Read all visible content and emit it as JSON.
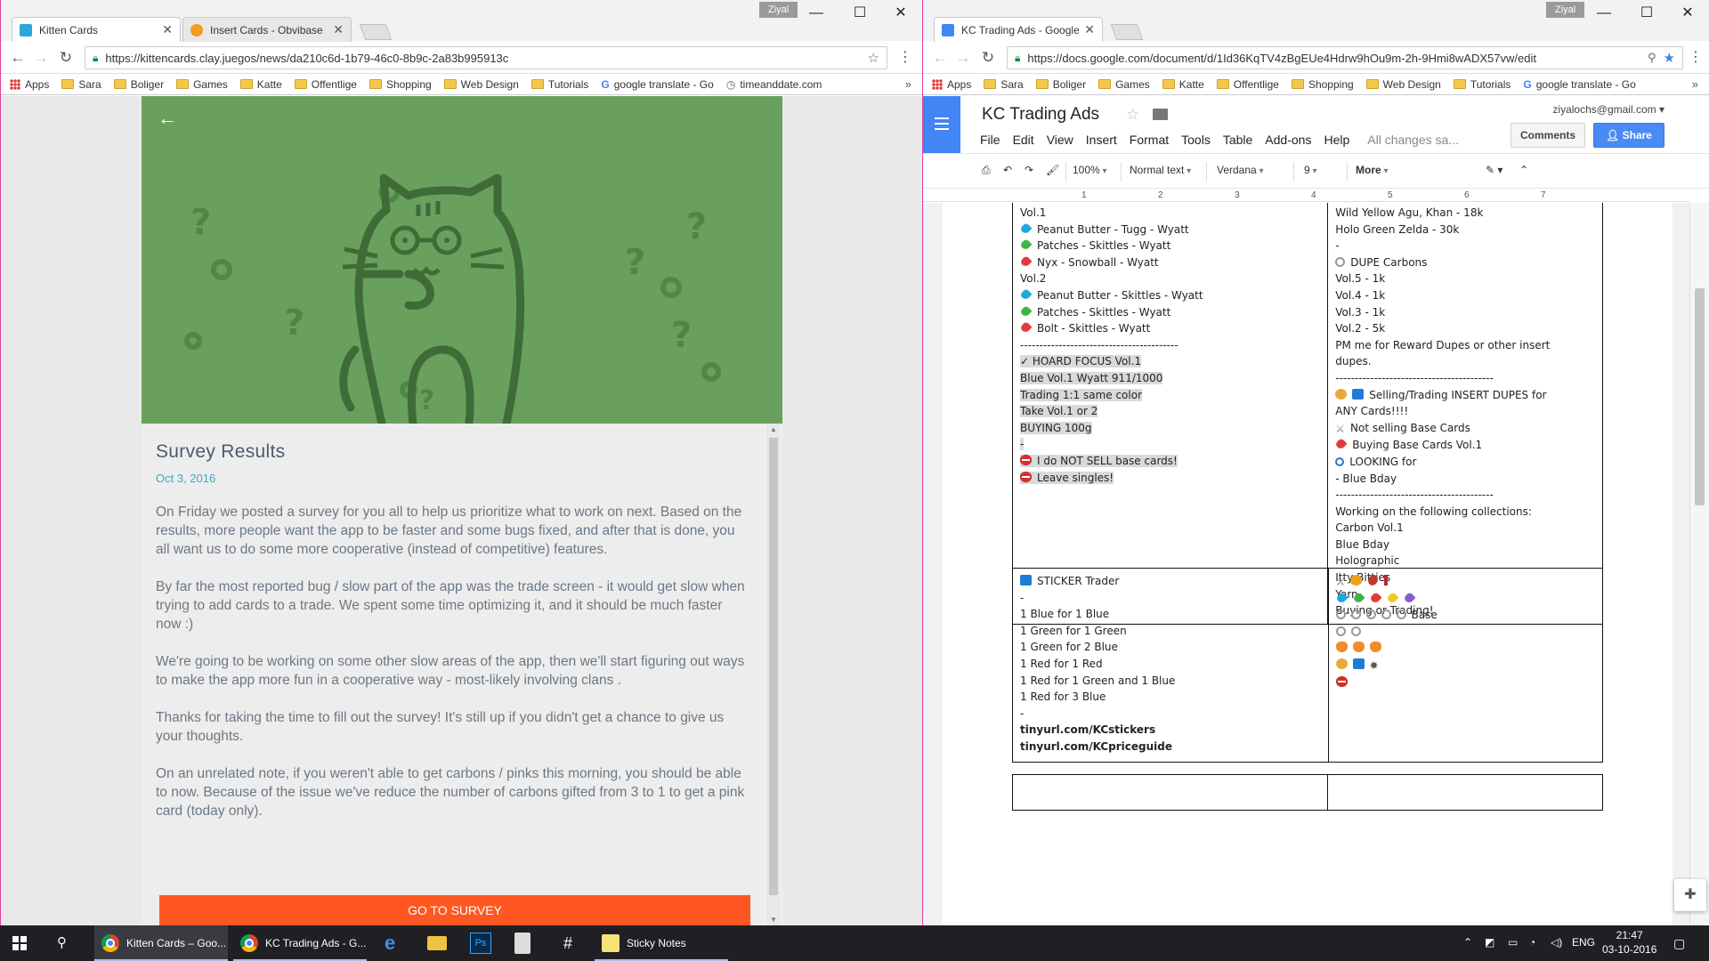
{
  "colors": {
    "hero_green": "#69a05e",
    "cat_dark": "#3f6b38",
    "cta_orange": "#ff5722",
    "date_blue": "#3aa8c8",
    "docs_blue": "#4285f4",
    "share_blue": "#4a8af4"
  },
  "left_window": {
    "user": "Ziyal",
    "tabs": [
      {
        "title": "Kitten Cards",
        "icon": "kittencards-favicon"
      },
      {
        "title": "Insert Cards - Obvibase",
        "icon": "obvibase-favicon"
      }
    ],
    "url": "https://kittencards.clay.juegos/news/da210c6d-1b79-46c0-8b9c-2a83b995913c",
    "bookmarks": [
      "Apps",
      "Sara",
      "Boliger",
      "Games",
      "Katte",
      "Offentlige",
      "Shopping",
      "Web Design",
      "Tutorials",
      "google translate - Go",
      "timeanddate.com"
    ],
    "article": {
      "title": "Survey Results",
      "date": "Oct 3, 2016",
      "paragraphs": [
        "On Friday we posted a survey for you all to help us prioritize what to work on next. Based on the results, more people want the app to be faster and some bugs fixed, and after that is done, you all want us to do some more cooperative (instead of competitive) features.",
        "By far the most reported bug / slow part of the app was the trade screen - it would get slow when trying to add cards to a trade. We spent some time optimizing it, and it should be much faster now :)",
        "We're going to be working on some other slow areas of the app, then we'll start figuring out ways to make the app more fun in a cooperative way - most-likely involving clans .",
        "Thanks for taking the time to fill out the survey! It's still up if you didn't get a chance to give us your thoughts.",
        "On an unrelated note, if you weren't able to get carbons / pinks this morning, you should be able to now. Because of the issue we've reduce the number of carbons gifted from 3 to 1 to get a pink card (today only)."
      ],
      "cta": "GO TO SURVEY"
    }
  },
  "right_window": {
    "user": "Ziyal",
    "tabs": [
      {
        "title": "KC Trading Ads - Google",
        "icon": "docs-favicon"
      }
    ],
    "url": "https://docs.google.com/document/d/1Id36KqTV4zBgEUe4Hdrw9hOu9m-2h-9Hmi8wADX57vw/edit",
    "bookmarks": [
      "Apps",
      "Sara",
      "Boliger",
      "Games",
      "Katte",
      "Offentlige",
      "Shopping",
      "Web Design",
      "Tutorials",
      "google translate - Go"
    ],
    "doc": {
      "title": "KC Trading Ads",
      "account": "ziyalochs@gmail.com",
      "menu": [
        "File",
        "Edit",
        "View",
        "Insert",
        "Format",
        "Tools",
        "Table",
        "Add-ons",
        "Help"
      ],
      "save_status": "All changes sa...",
      "comments_label": "Comments",
      "share_label": "Share",
      "toolbar": {
        "zoom": "100%",
        "style": "Normal text",
        "font": "Verdana",
        "size": "9",
        "more": "More"
      },
      "ruler_marks": [
        "1",
        "2",
        "3",
        "4",
        "5",
        "6",
        "7"
      ]
    },
    "table1": {
      "left_lines": [
        {
          "icon": "",
          "text": "Vol.1",
          "hl": false,
          "bold": false
        },
        {
          "icon": "heart-blue",
          "text": "Peanut Butter - Tugg - Wyatt",
          "hl": false,
          "bold": false
        },
        {
          "icon": "heart-green",
          "text": "Patches - Skittles - Wyatt",
          "hl": false,
          "bold": false
        },
        {
          "icon": "heart-red",
          "text": "Nyx - Snowball - Wyatt",
          "hl": false,
          "bold": false
        },
        {
          "icon": "",
          "text": "Vol.2",
          "hl": false,
          "bold": false
        },
        {
          "icon": "heart-blue",
          "text": "Peanut Butter - Skittles - Wyatt",
          "hl": false,
          "bold": false
        },
        {
          "icon": "heart-green",
          "text": "Patches - Skittles - Wyatt",
          "hl": false,
          "bold": false
        },
        {
          "icon": "heart-red",
          "text": "Bolt - Skittles - Wyatt",
          "hl": false,
          "bold": false
        },
        {
          "icon": "",
          "text": "-----------------------------------------",
          "hl": false,
          "bold": false
        },
        {
          "icon": "",
          "text": "✓ HOARD FOCUS Vol.1",
          "hl": true,
          "bold": false
        },
        {
          "icon": "",
          "text": "Blue Vol.1 Wyatt 911/1000",
          "hl": true,
          "bold": false
        },
        {
          "icon": "",
          "text": "Trading 1:1 same color",
          "hl": true,
          "bold": false
        },
        {
          "icon": "",
          "text": "Take Vol.1 or 2",
          "hl": true,
          "bold": false
        },
        {
          "icon": "",
          "text": "BUYING 100g",
          "hl": true,
          "bold": false
        },
        {
          "icon": "",
          "text": "-",
          "hl": true,
          "bold": false
        },
        {
          "icon": "no-entry",
          "text": "I do NOT SELL base cards!",
          "hl": true,
          "bold": false
        },
        {
          "icon": "no-entry",
          "text": "Leave singles!",
          "hl": true,
          "bold": false
        }
      ],
      "right_lines": [
        {
          "icon": "",
          "text": "Wild Yellow Agu, Khan - 18k"
        },
        {
          "icon": "",
          "text": "Holo Green Zelda - 30k"
        },
        {
          "icon": "",
          "text": "-"
        },
        {
          "icon": "disc",
          "text": "DUPE Carbons"
        },
        {
          "icon": "",
          "text": "Vol.5 - 1k"
        },
        {
          "icon": "",
          "text": "Vol.4 - 1k"
        },
        {
          "icon": "",
          "text": "Vol.3 - 1k"
        },
        {
          "icon": "",
          "text": "Vol.2 - 5k"
        },
        {
          "icon": "",
          "text": "PM me for Reward Dupes or other insert"
        },
        {
          "icon": "",
          "text": "dupes."
        },
        {
          "icon": "",
          "text": "-----------------------------------------"
        },
        {
          "icon": "medal+blue-square",
          "text": "Selling/Trading INSERT DUPES for"
        },
        {
          "icon": "",
          "text": "ANY Cards!!!!"
        },
        {
          "icon": "crossed",
          "text": "Not selling Base Cards"
        },
        {
          "icon": "heart-red",
          "text": "Buying Base Cards Vol.1"
        },
        {
          "icon": "search",
          "text": "LOOKING for"
        },
        {
          "icon": "",
          "text": "- Blue Bday"
        },
        {
          "icon": "",
          "text": "-----------------------------------------"
        },
        {
          "icon": "",
          "text": "Working on the following collections:"
        },
        {
          "icon": "",
          "text": "Carbon Vol.1"
        },
        {
          "icon": "",
          "text": "Blue Bday"
        },
        {
          "icon": "",
          "text": "Holographic"
        },
        {
          "icon": "",
          "text": "Itty Bitties"
        },
        {
          "icon": "",
          "text": "Yarn"
        },
        {
          "icon": "",
          "text": "Buying or Trading!"
        }
      ]
    },
    "table2": {
      "left_lines": [
        {
          "icon": "blue-square",
          "text": "STICKER Trader",
          "bold": false
        },
        {
          "icon": "",
          "text": "-",
          "bold": false
        },
        {
          "icon": "",
          "text": "1 Blue for 1 Blue",
          "bold": false
        },
        {
          "icon": "",
          "text": "1 Green for 1 Green",
          "bold": false
        },
        {
          "icon": "",
          "text": "1 Green for 2 Blue",
          "bold": false
        },
        {
          "icon": "",
          "text": "1 Red for 1 Red",
          "bold": false
        },
        {
          "icon": "",
          "text": "1 Red for 1 Green and 1 Blue",
          "bold": false
        },
        {
          "icon": "",
          "text": "1 Red for 3 Blue",
          "bold": false
        },
        {
          "icon": "",
          "text": "-",
          "bold": false
        },
        {
          "icon": "",
          "text": "tinyurl.com/KCstickers",
          "bold": true
        },
        {
          "icon": "",
          "text": "tinyurl.com/KCpriceguide",
          "bold": true
        }
      ],
      "right_rows": [
        {
          "icons": [
            "crossed",
            "flame",
            "mango",
            "mark"
          ],
          "text": ""
        },
        {
          "icons": [
            "heart-blue",
            "heart-green",
            "heart-red",
            "heart-yellow",
            "heart-purple"
          ],
          "text": ""
        },
        {
          "icons": [
            "disc",
            "disc",
            "disc",
            "disc",
            "disc"
          ],
          "text": "Base"
        },
        {
          "icons": [
            "disc",
            "disc"
          ],
          "text": ""
        },
        {
          "icons": [
            "cat",
            "cat",
            "cat"
          ],
          "text": ""
        },
        {
          "icons": [
            "medal",
            "blue-square",
            "star-burst"
          ],
          "text": ""
        },
        {
          "icons": [
            "no-entry"
          ],
          "text": ""
        }
      ]
    }
  },
  "taskbar": {
    "tasks": [
      {
        "title": "Kitten Cards – Goo...",
        "active": true
      },
      {
        "title": "KC Trading Ads - G...",
        "active": false
      },
      {
        "title": "Sticky Notes",
        "active": false
      }
    ],
    "pinned": [
      "edge-icon",
      "file-explorer-icon",
      "photoshop-icon",
      "calculator-icon",
      "slack-icon"
    ],
    "language": "ENG",
    "time": "21:47",
    "date": "03-10-2016"
  }
}
